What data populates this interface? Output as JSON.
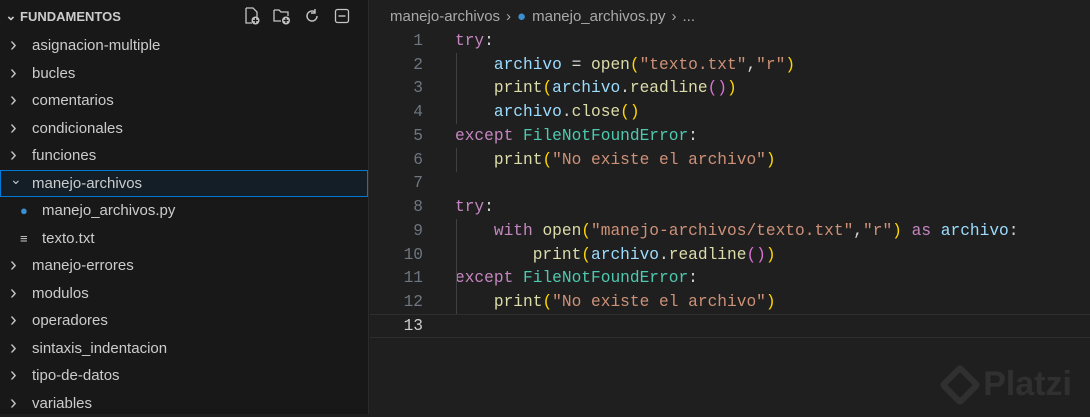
{
  "sidebar": {
    "title": "FUNDAMENTOS",
    "actions": [
      "new-file",
      "new-folder",
      "refresh",
      "collapse-all"
    ],
    "items": [
      {
        "label": "asignacion-multiple",
        "type": "folder"
      },
      {
        "label": "bucles",
        "type": "folder"
      },
      {
        "label": "comentarios",
        "type": "folder"
      },
      {
        "label": "condicionales",
        "type": "folder"
      },
      {
        "label": "funciones",
        "type": "folder"
      },
      {
        "label": "manejo-archivos",
        "type": "folder-open",
        "selected": true
      },
      {
        "label": "manejo_archivos.py",
        "type": "python"
      },
      {
        "label": "texto.txt",
        "type": "text"
      },
      {
        "label": "manejo-errores",
        "type": "folder"
      },
      {
        "label": "modulos",
        "type": "folder"
      },
      {
        "label": "operadores",
        "type": "folder"
      },
      {
        "label": "sintaxis_indentacion",
        "type": "folder"
      },
      {
        "label": "tipo-de-datos",
        "type": "folder"
      },
      {
        "label": "variables",
        "type": "folder"
      }
    ]
  },
  "breadcrumb": {
    "folder": "manejo-archivos",
    "file": "manejo_archivos.py",
    "more": "..."
  },
  "watermark": "Platzi",
  "code": [
    [
      [
        "k",
        "try"
      ],
      [
        "p",
        ":"
      ]
    ],
    [
      [
        "p",
        "    "
      ],
      [
        "v",
        "archivo"
      ],
      [
        "p",
        " = "
      ],
      [
        "f",
        "open"
      ],
      [
        "b1",
        "("
      ],
      [
        "s",
        "\"texto.txt\""
      ],
      [
        "p",
        ","
      ],
      [
        "s",
        "\"r\""
      ],
      [
        "b1",
        ")"
      ]
    ],
    [
      [
        "p",
        "    "
      ],
      [
        "f",
        "print"
      ],
      [
        "b1",
        "("
      ],
      [
        "v",
        "archivo"
      ],
      [
        "p",
        "."
      ],
      [
        "f",
        "readline"
      ],
      [
        "b2",
        "()"
      ],
      [
        "b1",
        ")"
      ]
    ],
    [
      [
        "p",
        "    "
      ],
      [
        "v",
        "archivo"
      ],
      [
        "p",
        "."
      ],
      [
        "f",
        "close"
      ],
      [
        "b1",
        "()"
      ]
    ],
    [
      [
        "k",
        "except"
      ],
      [
        "p",
        " "
      ],
      [
        "c",
        "FileNotFoundError"
      ],
      [
        "p",
        ":"
      ]
    ],
    [
      [
        "p",
        "    "
      ],
      [
        "f",
        "print"
      ],
      [
        "b1",
        "("
      ],
      [
        "s",
        "\"No existe el archivo\""
      ],
      [
        "b1",
        ")"
      ]
    ],
    [],
    [
      [
        "k",
        "try"
      ],
      [
        "p",
        ":"
      ]
    ],
    [
      [
        "p",
        "    "
      ],
      [
        "k",
        "with"
      ],
      [
        "p",
        " "
      ],
      [
        "f",
        "open"
      ],
      [
        "b1",
        "("
      ],
      [
        "s",
        "\"manejo-archivos/texto.txt\""
      ],
      [
        "p",
        ","
      ],
      [
        "s",
        "\"r\""
      ],
      [
        "b1",
        ")"
      ],
      [
        "p",
        " "
      ],
      [
        "k",
        "as"
      ],
      [
        "p",
        " "
      ],
      [
        "v",
        "archivo"
      ],
      [
        "p",
        ":"
      ]
    ],
    [
      [
        "p",
        "        "
      ],
      [
        "f",
        "print"
      ],
      [
        "b1",
        "("
      ],
      [
        "v",
        "archivo"
      ],
      [
        "p",
        "."
      ],
      [
        "f",
        "readline"
      ],
      [
        "b2",
        "()"
      ],
      [
        "b1",
        ")"
      ]
    ],
    [
      [
        "k",
        "except"
      ],
      [
        "p",
        " "
      ],
      [
        "c",
        "FileNotFoundError"
      ],
      [
        "p",
        ":"
      ]
    ],
    [
      [
        "p",
        "    "
      ],
      [
        "f",
        "print"
      ],
      [
        "b1",
        "("
      ],
      [
        "s",
        "\"No existe el archivo\""
      ],
      [
        "b1",
        ")"
      ]
    ],
    []
  ],
  "current_line": 13
}
